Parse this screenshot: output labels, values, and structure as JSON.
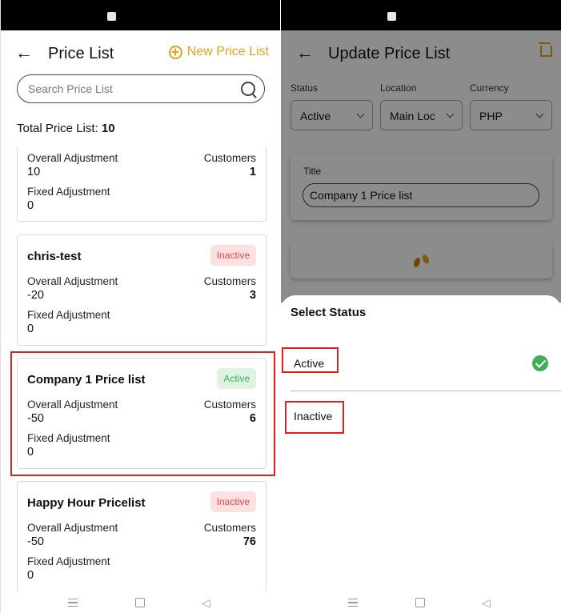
{
  "left": {
    "header": {
      "title": "Price List",
      "new_button": "New Price List"
    },
    "search": {
      "placeholder": "Search Price List"
    },
    "total": {
      "label": "Total Price List: ",
      "count": "10"
    },
    "cards": [
      {
        "name": "",
        "status": "",
        "overall_label": "Overall Adjustment",
        "overall": "10",
        "customers_label": "Customers",
        "customers": "1",
        "fixed_label": "Fixed Adjustment",
        "fixed": "0"
      },
      {
        "name": "chris-test",
        "status": "Inactive",
        "overall_label": "Overall Adjustment",
        "overall": "-20",
        "customers_label": "Customers",
        "customers": "3",
        "fixed_label": "Fixed Adjustment",
        "fixed": "0"
      },
      {
        "name": "Company 1 Price list",
        "status": "Active",
        "overall_label": "Overall Adjustment",
        "overall": "-50",
        "customers_label": "Customers",
        "customers": "6",
        "fixed_label": "Fixed Adjustment",
        "fixed": "0"
      },
      {
        "name": "Happy Hour Pricelist",
        "status": "Inactive",
        "overall_label": "Overall Adjustment",
        "overall": "-50",
        "customers_label": "Customers",
        "customers": "76",
        "fixed_label": "Fixed Adjustment",
        "fixed": "0"
      }
    ]
  },
  "right": {
    "header": {
      "title": "Update Price List"
    },
    "fields": {
      "status_label": "Status",
      "status_value": "Active",
      "location_label": "Location",
      "location_value": "Main Loc",
      "currency_label": "Currency",
      "currency_value": "PHP"
    },
    "title_section": {
      "label": "Title",
      "value": "Company 1 Price list"
    },
    "sheet": {
      "title": "Select Status",
      "options": [
        {
          "label": "Active",
          "selected": true
        },
        {
          "label": "Inactive",
          "selected": false
        }
      ]
    }
  },
  "colors": {
    "accent": "#e7a11f",
    "active": "#3fae57",
    "inactive": "#e04b4b",
    "highlight": "#e02020"
  }
}
